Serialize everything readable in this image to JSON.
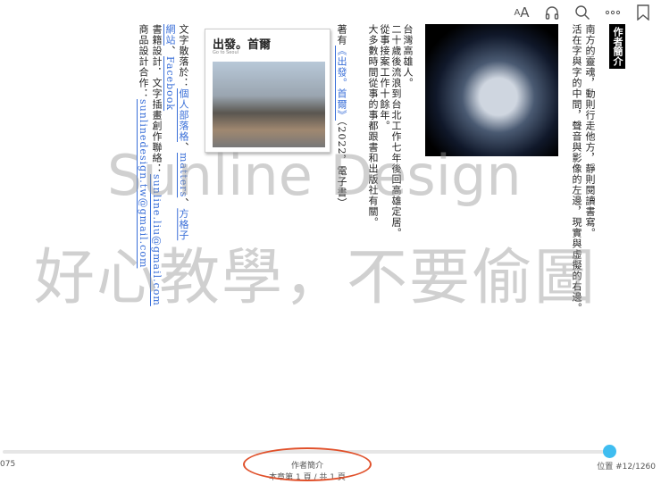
{
  "toolbar": {
    "font_icon_label": "AA",
    "items": [
      "font-size-icon",
      "headphones-icon",
      "search-icon",
      "more-icon",
      "bookmark-icon"
    ]
  },
  "section_label": "作者簡介",
  "bio_lines": [
    "南方的靈魂，動則行走他方，靜則閱讀書寫。",
    "活在字與字的中間，聲音與影像的左邊，現實與虛擬的右邊。",
    "台灣高雄人。",
    "二十歲後流浪到台北工作七年後回高雄定居。",
    "從事接案工作十餘年。",
    "大多數時間從事的事都跟書和出版社有關。"
  ],
  "works": {
    "prefix": "著有",
    "book_link": "《出發。首爾》",
    "suffix": "（2022，電子書）"
  },
  "cover": {
    "title": "出發。首爾",
    "subtitle": "Go to Seoul"
  },
  "links": {
    "scatter_prefix": "文字散落於：",
    "blog": "個人部落格",
    "sep1": "、",
    "matters": "matters",
    "sep2": "、",
    "fangezi": "方格子",
    "website": "網站",
    "sep3": "、",
    "facebook": "Facebook",
    "design_prefix": "書籍設計．文字插畫創作聯絡：",
    "design_email": "sunline.liu@gmail.com",
    "product_prefix": "商品設計合作：",
    "product_email": "sunlinedesign.tw@gmail.com"
  },
  "watermark": {
    "line1": "Sunline Design",
    "line2": "好心教學，不要偷圖"
  },
  "footer": {
    "left_number": "075",
    "chapter": "作者簡介",
    "page_info": "本章第 1 頁 / 共 1 頁",
    "position": "位置 #12/1260",
    "progress": 0.93
  },
  "colors": {
    "accent": "#3fbdf0",
    "annotation": "#e0502a",
    "link": "#3a6fd8"
  }
}
